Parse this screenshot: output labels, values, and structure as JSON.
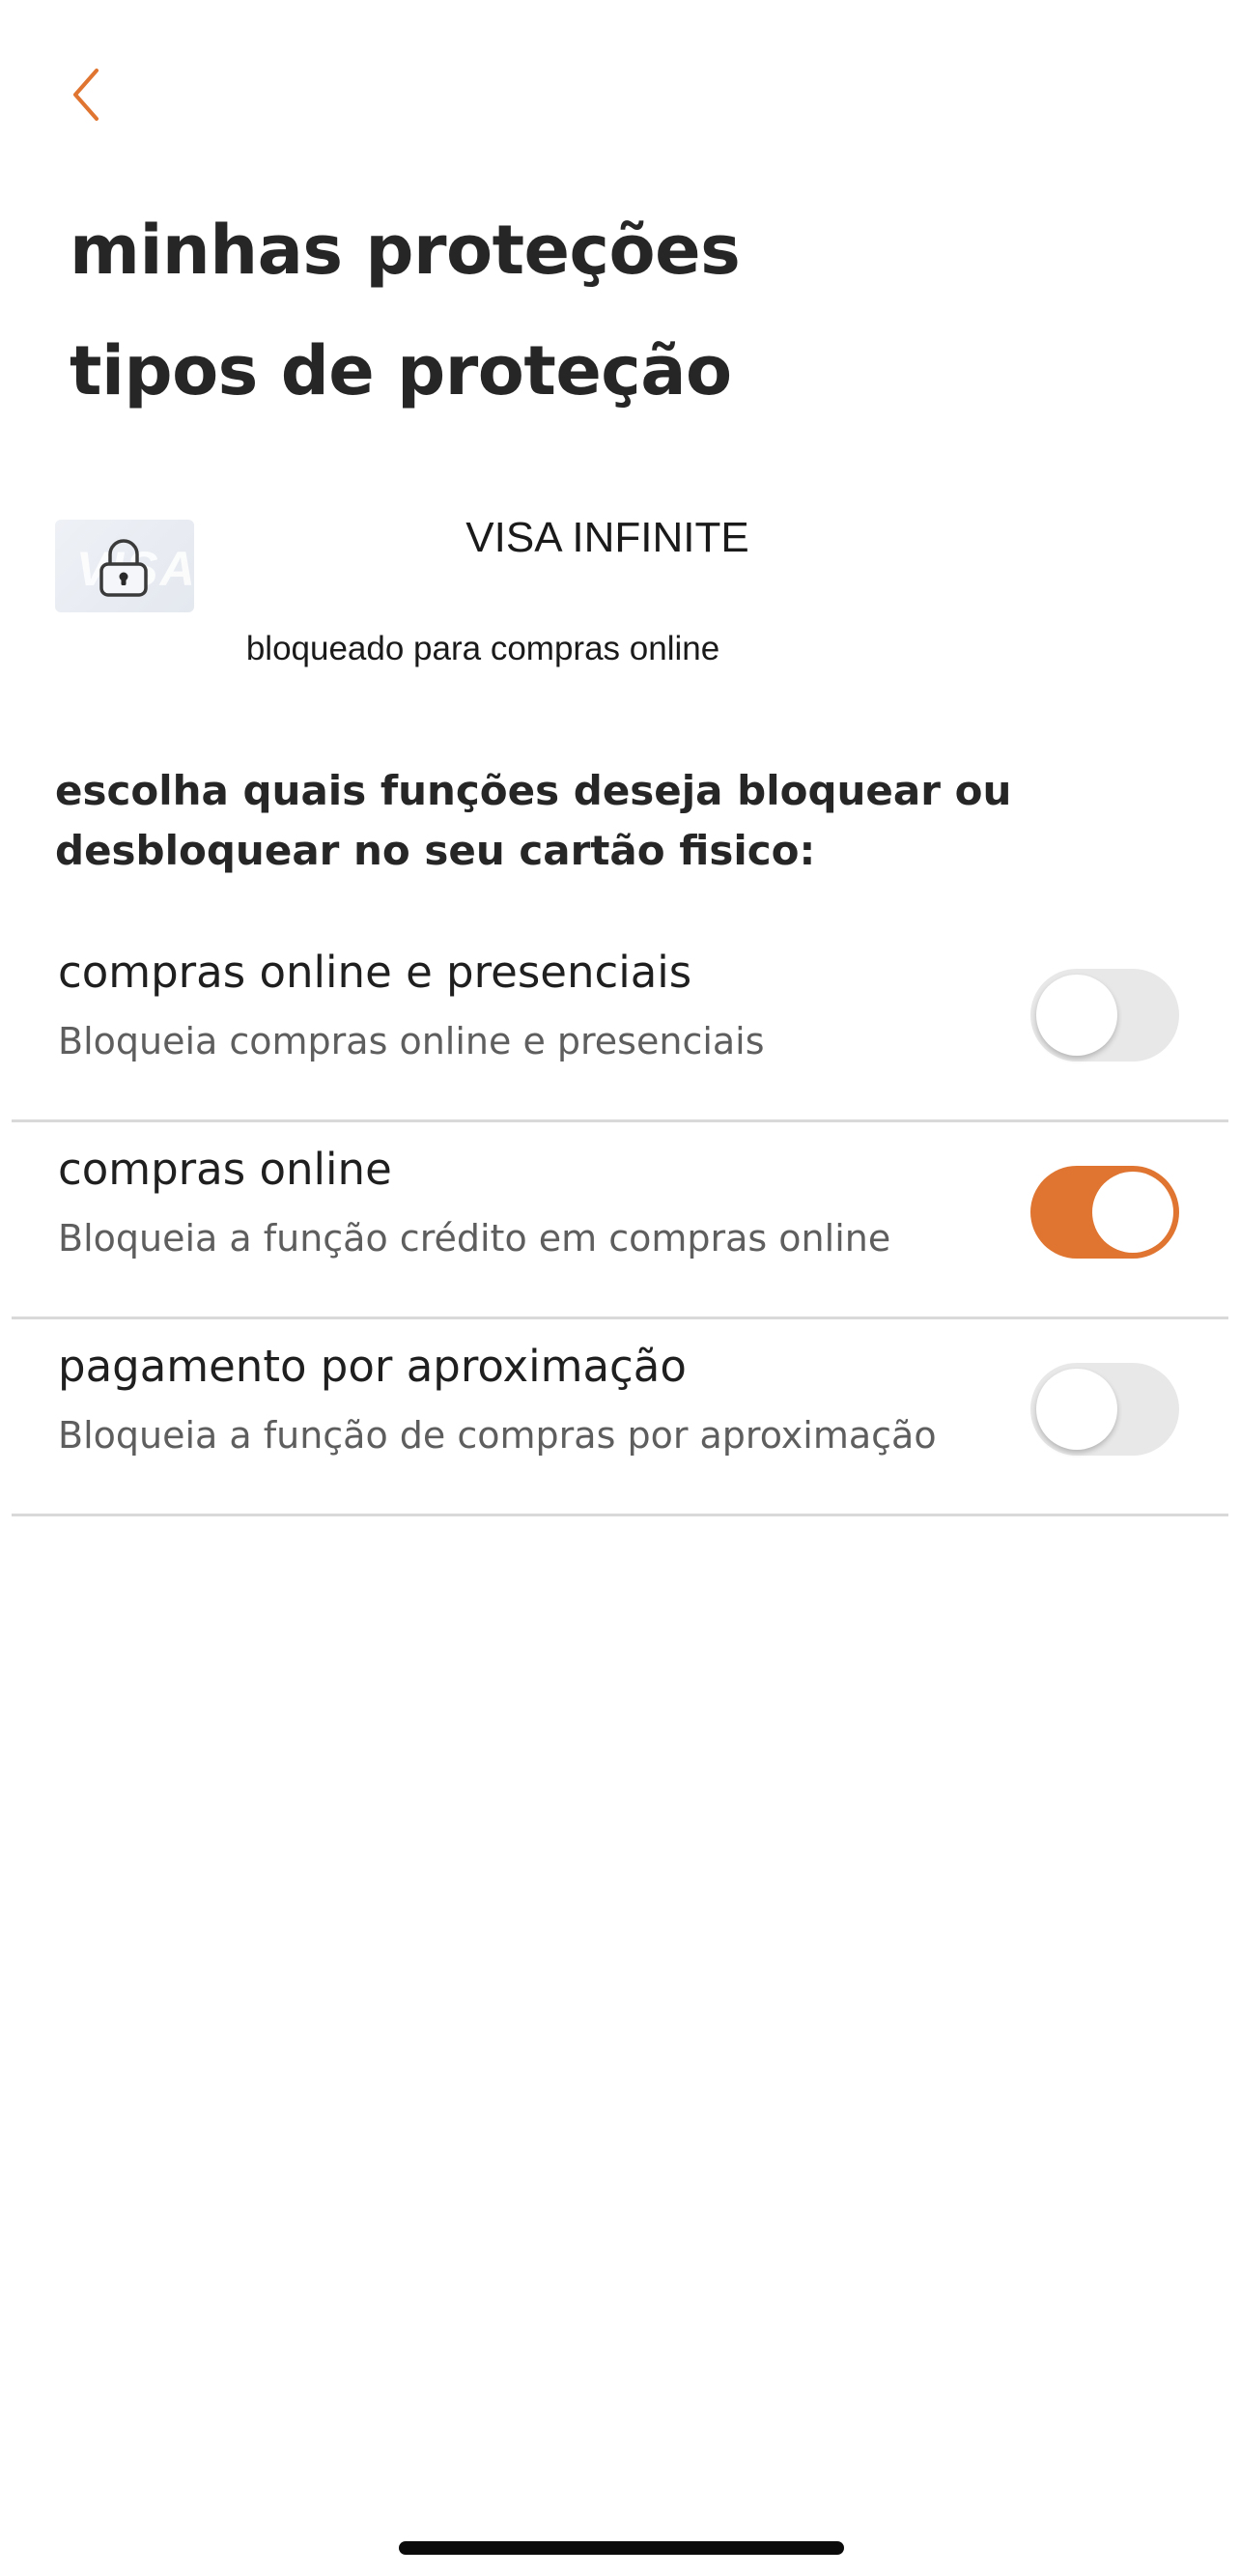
{
  "header": {
    "back_icon": "chevron-left-icon",
    "accent_color": "#df7530",
    "title": "minhas proteções"
  },
  "section": {
    "title": "tipos de proteção"
  },
  "card": {
    "brand_text": "VISA",
    "lock_icon": "lock-icon",
    "name": "VISA INFINITE",
    "status": "bloqueado para compras online"
  },
  "instructions": "escolha quais funções deseja bloquear ou desbloquear no seu cartão fisico:",
  "options": [
    {
      "title": "compras online e presenciais",
      "description": "Bloqueia compras online e presenciais",
      "enabled": false
    },
    {
      "title": "compras online",
      "description": "Bloqueia a função crédito em compras online",
      "enabled": true
    },
    {
      "title": "pagamento por aproximação",
      "description": "Bloqueia a função de compras por aproximação",
      "enabled": false
    }
  ],
  "colors": {
    "toggle_on": "#df7530",
    "toggle_off": "#e8e8e8",
    "divider": "#d9d9d9"
  }
}
